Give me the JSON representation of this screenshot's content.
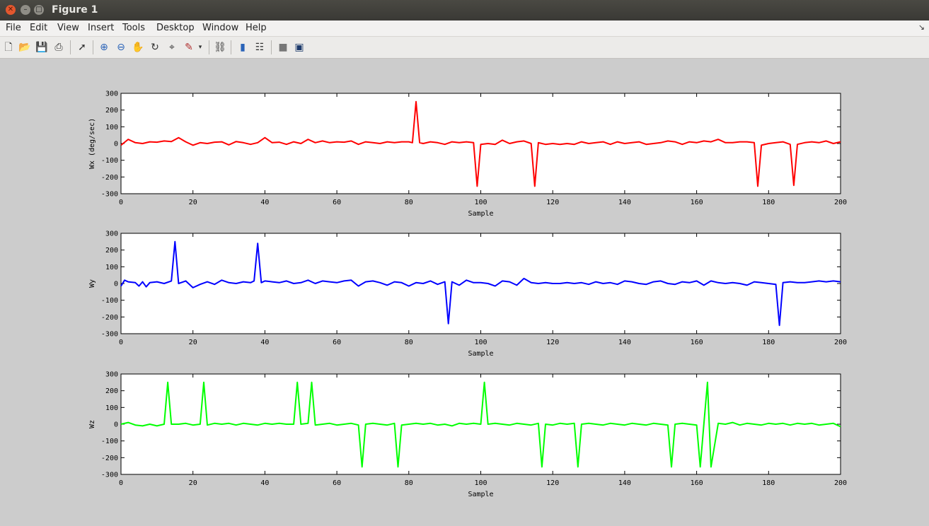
{
  "window": {
    "title": "Figure 1"
  },
  "menu": [
    "File",
    "Edit",
    "View",
    "Insert",
    "Tools",
    "Desktop",
    "Window",
    "Help"
  ],
  "toolbar_icons": [
    "new-figure-icon",
    "open-icon",
    "save-icon",
    "print-icon",
    "pointer-icon",
    "zoom-in-icon",
    "zoom-out-icon",
    "pan-icon",
    "rotate-icon",
    "data-cursor-icon",
    "brush-icon",
    "brush-dropdown-icon",
    "link-icon",
    "colorbar-icon",
    "legend-icon",
    "hide-plot-tools-icon",
    "show-plot-tools-icon"
  ],
  "chart_data": [
    {
      "type": "line",
      "xlabel": "Sample",
      "ylabel": "Wx (deg/sec)",
      "xlim": [
        0,
        200
      ],
      "ylim": [
        -300,
        300
      ],
      "xticks": [
        0,
        20,
        40,
        60,
        80,
        100,
        120,
        140,
        160,
        180,
        200
      ],
      "yticks": [
        300,
        200,
        100,
        0,
        -100,
        -200,
        -300
      ],
      "color": "#ff0000",
      "series": [
        {
          "x": [
            0,
            2,
            4,
            6,
            8,
            10,
            12,
            14,
            16,
            18,
            20,
            22,
            24,
            26,
            28,
            30,
            32,
            34,
            36,
            38,
            40,
            42,
            44,
            46,
            48,
            50,
            52,
            54,
            56,
            58,
            60,
            62,
            64,
            66,
            68,
            70,
            72,
            74,
            76,
            78,
            80,
            81,
            82,
            83,
            84,
            86,
            88,
            90,
            92,
            94,
            96,
            98,
            99,
            100,
            102,
            104,
            106,
            108,
            110,
            112,
            114,
            115,
            116,
            118,
            120,
            122,
            124,
            126,
            128,
            130,
            132,
            134,
            136,
            138,
            140,
            142,
            144,
            146,
            148,
            150,
            152,
            154,
            156,
            158,
            160,
            162,
            164,
            166,
            168,
            170,
            172,
            174,
            176,
            177,
            178,
            180,
            182,
            184,
            186,
            187,
            188,
            190,
            192,
            194,
            196,
            198,
            200
          ],
          "y": [
            -10,
            25,
            5,
            0,
            10,
            8,
            15,
            12,
            35,
            10,
            -10,
            5,
            0,
            8,
            10,
            -8,
            12,
            5,
            -5,
            5,
            35,
            5,
            8,
            -5,
            10,
            0,
            25,
            5,
            15,
            5,
            10,
            8,
            15,
            -5,
            10,
            5,
            0,
            10,
            5,
            10,
            10,
            5,
            250,
            5,
            0,
            10,
            5,
            -5,
            10,
            5,
            10,
            5,
            -255,
            -5,
            0,
            -5,
            20,
            0,
            10,
            15,
            0,
            -255,
            5,
            -5,
            0,
            -5,
            0,
            -5,
            10,
            0,
            5,
            10,
            -5,
            10,
            0,
            5,
            10,
            -5,
            0,
            5,
            15,
            10,
            -5,
            10,
            5,
            15,
            10,
            25,
            5,
            5,
            10,
            10,
            5,
            -255,
            -10,
            0,
            5,
            10,
            -5,
            -250,
            -5,
            5,
            10,
            5,
            15,
            0,
            10
          ]
        }
      ]
    },
    {
      "type": "line",
      "xlabel": "Sample",
      "ylabel": "Wy",
      "xlim": [
        0,
        200
      ],
      "ylim": [
        -300,
        300
      ],
      "xticks": [
        0,
        20,
        40,
        60,
        80,
        100,
        120,
        140,
        160,
        180,
        200
      ],
      "yticks": [
        300,
        200,
        100,
        0,
        -100,
        -200,
        -300
      ],
      "color": "#0000ff",
      "series": [
        {
          "x": [
            0,
            1,
            2,
            4,
            5,
            6,
            7,
            8,
            10,
            12,
            14,
            15,
            16,
            18,
            20,
            22,
            24,
            26,
            28,
            30,
            32,
            34,
            36,
            37,
            38,
            39,
            40,
            42,
            44,
            46,
            48,
            50,
            52,
            54,
            56,
            58,
            60,
            62,
            64,
            66,
            68,
            70,
            72,
            74,
            76,
            78,
            80,
            82,
            84,
            86,
            88,
            90,
            91,
            92,
            94,
            96,
            98,
            100,
            102,
            104,
            106,
            108,
            110,
            112,
            114,
            116,
            118,
            120,
            122,
            124,
            126,
            128,
            130,
            132,
            134,
            136,
            138,
            140,
            142,
            144,
            146,
            148,
            150,
            152,
            154,
            156,
            158,
            160,
            162,
            164,
            166,
            168,
            170,
            172,
            174,
            176,
            178,
            180,
            182,
            183,
            184,
            186,
            188,
            190,
            192,
            194,
            196,
            198,
            200
          ],
          "y": [
            -15,
            20,
            10,
            5,
            -15,
            10,
            -20,
            5,
            10,
            0,
            15,
            250,
            0,
            15,
            -25,
            -5,
            10,
            -5,
            20,
            5,
            0,
            10,
            5,
            15,
            240,
            5,
            15,
            10,
            5,
            15,
            0,
            5,
            20,
            0,
            15,
            10,
            5,
            15,
            20,
            -15,
            10,
            15,
            5,
            -10,
            10,
            5,
            -15,
            5,
            0,
            15,
            -5,
            10,
            -240,
            10,
            -10,
            20,
            5,
            5,
            0,
            -15,
            15,
            10,
            -10,
            30,
            5,
            0,
            5,
            0,
            0,
            5,
            0,
            5,
            -5,
            10,
            0,
            5,
            -5,
            15,
            10,
            0,
            -5,
            10,
            15,
            0,
            -5,
            10,
            5,
            15,
            -10,
            15,
            5,
            0,
            5,
            0,
            -10,
            10,
            5,
            0,
            -5,
            -250,
            5,
            10,
            5,
            5,
            10,
            15,
            10,
            15,
            10
          ]
        }
      ]
    },
    {
      "type": "line",
      "xlabel": "Sample",
      "ylabel": "Wz",
      "xlim": [
        0,
        200
      ],
      "ylim": [
        -300,
        300
      ],
      "xticks": [
        0,
        20,
        40,
        60,
        80,
        100,
        120,
        140,
        160,
        180,
        200
      ],
      "yticks": [
        300,
        200,
        100,
        0,
        -100,
        -200,
        -300
      ],
      "color": "#00ff00",
      "series": [
        {
          "x": [
            0,
            2,
            4,
            6,
            8,
            10,
            12,
            13,
            14,
            16,
            18,
            20,
            22,
            23,
            24,
            26,
            28,
            30,
            32,
            34,
            36,
            38,
            40,
            42,
            44,
            46,
            48,
            49,
            50,
            52,
            53,
            54,
            56,
            58,
            60,
            62,
            64,
            66,
            67,
            68,
            70,
            72,
            74,
            76,
            77,
            78,
            80,
            82,
            84,
            86,
            88,
            90,
            92,
            94,
            96,
            98,
            100,
            101,
            102,
            104,
            106,
            108,
            110,
            112,
            114,
            116,
            117,
            118,
            120,
            122,
            124,
            126,
            127,
            128,
            130,
            132,
            134,
            136,
            138,
            140,
            142,
            144,
            146,
            148,
            150,
            152,
            153,
            154,
            156,
            158,
            160,
            161,
            162,
            163,
            164,
            166,
            168,
            170,
            172,
            174,
            176,
            178,
            180,
            182,
            184,
            186,
            188,
            190,
            192,
            194,
            196,
            198,
            200
          ],
          "y": [
            0,
            10,
            -5,
            -10,
            0,
            -10,
            0,
            250,
            0,
            0,
            5,
            -5,
            0,
            250,
            -5,
            5,
            0,
            5,
            -5,
            5,
            0,
            -5,
            5,
            0,
            5,
            0,
            0,
            250,
            0,
            5,
            250,
            -5,
            0,
            5,
            -5,
            0,
            5,
            -5,
            -255,
            0,
            5,
            0,
            -5,
            5,
            -255,
            -5,
            0,
            5,
            0,
            5,
            -5,
            0,
            -10,
            5,
            0,
            5,
            0,
            250,
            0,
            5,
            0,
            -5,
            5,
            0,
            -5,
            5,
            -255,
            0,
            -5,
            5,
            0,
            5,
            -255,
            0,
            5,
            0,
            -5,
            5,
            0,
            -5,
            5,
            0,
            -5,
            5,
            0,
            -5,
            -255,
            0,
            5,
            0,
            -5,
            -255,
            0,
            250,
            -255,
            5,
            0,
            10,
            -5,
            5,
            0,
            -5,
            5,
            0,
            5,
            -5,
            5,
            0,
            5,
            -5,
            0,
            5,
            -15
          ]
        }
      ]
    }
  ]
}
